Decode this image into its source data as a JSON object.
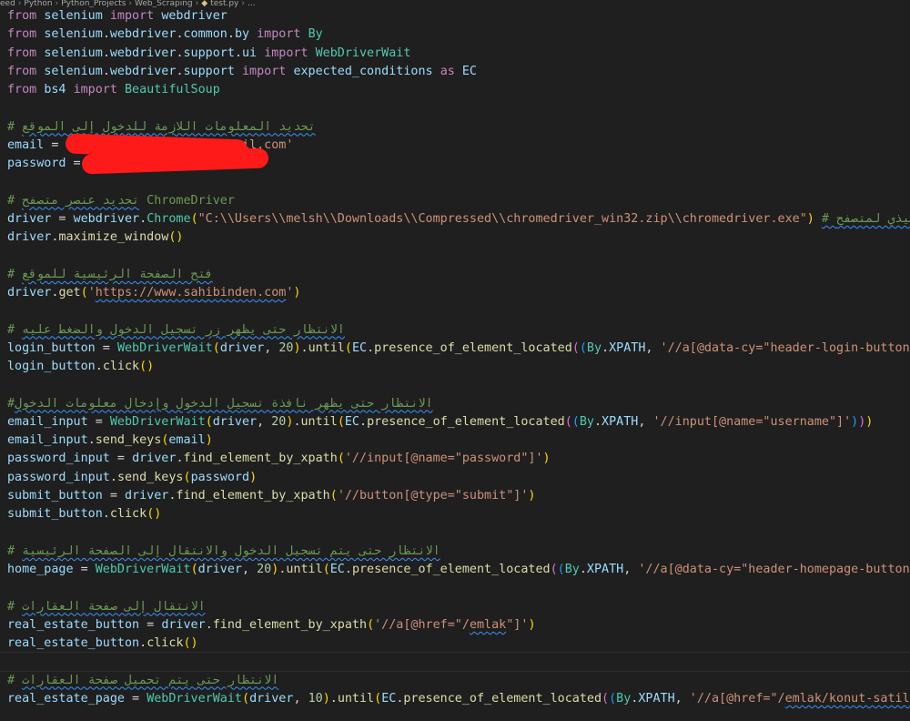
{
  "breadcrumb": [
    "eed",
    "Python",
    "Python_Projects",
    "Web_Scraping",
    "test.py",
    "..."
  ],
  "colors": {
    "background": "#1f1f1f",
    "keyword": "#c586c0",
    "variable": "#9cdcfe",
    "function": "#dcdcaa",
    "class": "#4ec9b0",
    "string": "#ce9178",
    "number": "#b5cea8",
    "comment": "#6a9955",
    "redaction": "#ff1a1a"
  },
  "code_lines": [
    [
      [
        "from",
        "kw"
      ],
      [
        " ",
        ""
      ],
      [
        "selenium",
        "var"
      ],
      [
        " ",
        ""
      ],
      [
        "import",
        "kw"
      ],
      [
        " ",
        ""
      ],
      [
        "webdriver",
        "var"
      ]
    ],
    [
      [
        "from",
        "kw"
      ],
      [
        " ",
        ""
      ],
      [
        "selenium",
        "var"
      ],
      [
        ".",
        ""
      ],
      [
        "webdriver",
        "var"
      ],
      [
        ".",
        ""
      ],
      [
        "common",
        "var"
      ],
      [
        ".",
        ""
      ],
      [
        "by",
        "var"
      ],
      [
        " ",
        ""
      ],
      [
        "import",
        "kw"
      ],
      [
        " ",
        ""
      ],
      [
        "By",
        "cls"
      ]
    ],
    [
      [
        "from",
        "kw"
      ],
      [
        " ",
        ""
      ],
      [
        "selenium",
        "var"
      ],
      [
        ".",
        ""
      ],
      [
        "webdriver",
        "var"
      ],
      [
        ".",
        ""
      ],
      [
        "support",
        "var"
      ],
      [
        ".",
        ""
      ],
      [
        "ui",
        "var"
      ],
      [
        " ",
        ""
      ],
      [
        "import",
        "kw"
      ],
      [
        " ",
        ""
      ],
      [
        "WebDriverWait",
        "cls"
      ]
    ],
    [
      [
        "from",
        "kw"
      ],
      [
        " ",
        ""
      ],
      [
        "selenium",
        "var"
      ],
      [
        ".",
        ""
      ],
      [
        "webdriver",
        "var"
      ],
      [
        ".",
        ""
      ],
      [
        "support",
        "var"
      ],
      [
        " ",
        ""
      ],
      [
        "import",
        "kw"
      ],
      [
        " ",
        ""
      ],
      [
        "expected_conditions",
        "var"
      ],
      [
        " ",
        ""
      ],
      [
        "as",
        "kw"
      ],
      [
        " ",
        ""
      ],
      [
        "EC",
        "var"
      ]
    ],
    [
      [
        "from",
        "kw"
      ],
      [
        " ",
        ""
      ],
      [
        "bs4",
        "var"
      ],
      [
        " ",
        ""
      ],
      [
        "import",
        "kw"
      ],
      [
        " ",
        ""
      ],
      [
        "BeautifulSoup",
        "cls"
      ]
    ],
    [],
    [
      [
        "# ",
        "com"
      ],
      [
        "تحديد المعلومات اللازمة للدخول إلى الموقع",
        "com sq"
      ]
    ],
    [
      [
        "email",
        "var"
      ],
      [
        " = ",
        ""
      ],
      [
        "'",
        "str"
      ],
      [
        "                   ",
        "str"
      ],
      [
        "@gmail.com'",
        "str"
      ]
    ],
    [
      [
        "password",
        "var"
      ],
      [
        " = ",
        ""
      ],
      [
        "'",
        "str"
      ],
      [
        "              '",
        "str"
      ]
    ],
    [],
    [
      [
        "# ",
        "com"
      ],
      [
        "تحديد عنصر متصفح",
        "com sq"
      ],
      [
        " ChromeDriver",
        "com"
      ]
    ],
    [
      [
        "driver",
        "var"
      ],
      [
        " = ",
        ""
      ],
      [
        "webdriver",
        "var"
      ],
      [
        ".",
        ""
      ],
      [
        "Chrome",
        "cls"
      ],
      [
        "(",
        "p1"
      ],
      [
        "\"C:\\\\Users\\\\melsh\\\\Downloads\\\\Compressed\\\\chromedriver_win32.zip\\\\chromedriver.exe\"",
        "str"
      ],
      [
        ")",
        "p1"
      ],
      [
        " ",
        ""
      ],
      [
        "# مسار الملف التنفيذي لمتصفح",
        "com sq"
      ]
    ],
    [
      [
        "driver",
        "var"
      ],
      [
        ".",
        ""
      ],
      [
        "maximize_window",
        "fn"
      ],
      [
        "()",
        "p1"
      ]
    ],
    [],
    [
      [
        "# ",
        "com"
      ],
      [
        "فتح الصفحة الرئيسية للموقع",
        "com sq"
      ]
    ],
    [
      [
        "driver",
        "var"
      ],
      [
        ".",
        ""
      ],
      [
        "get",
        "fn"
      ],
      [
        "(",
        "p1"
      ],
      [
        "'",
        "str"
      ],
      [
        "https://www.sahibinden.com",
        "str sq"
      ],
      [
        "'",
        "str"
      ],
      [
        ")",
        "p1"
      ]
    ],
    [],
    [
      [
        "# ",
        "com"
      ],
      [
        "الانتظار حتى يظهر زر تسجيل الدخول والضغط عليه",
        "com sq"
      ]
    ],
    [
      [
        "login_button",
        "var"
      ],
      [
        " = ",
        ""
      ],
      [
        "WebDriverWait",
        "cls"
      ],
      [
        "(",
        "p1"
      ],
      [
        "driver",
        "var"
      ],
      [
        ", ",
        ""
      ],
      [
        "20",
        "num"
      ],
      [
        ")",
        "p1"
      ],
      [
        ".",
        ""
      ],
      [
        "until",
        "fn"
      ],
      [
        "(",
        "p1"
      ],
      [
        "EC",
        "var"
      ],
      [
        ".",
        ""
      ],
      [
        "presence_of_element_located",
        "fn"
      ],
      [
        "(",
        "p2"
      ],
      [
        "(",
        "p3"
      ],
      [
        "By",
        "cls"
      ],
      [
        ".",
        ""
      ],
      [
        "XPATH",
        "var"
      ],
      [
        ", ",
        ""
      ],
      [
        "'//a[@data-cy=\"header-login-button\"]'",
        "str"
      ],
      [
        ")",
        "p3"
      ],
      [
        ")",
        "p2"
      ],
      [
        ")",
        "p1"
      ]
    ],
    [
      [
        "login_button",
        "var"
      ],
      [
        ".",
        ""
      ],
      [
        "click",
        "fn"
      ],
      [
        "()",
        "p1"
      ]
    ],
    [],
    [
      [
        "#",
        "com"
      ],
      [
        "الانتظار حتى يظهر نافذة تسجيل الدخول وإدخال معلومات الدخول",
        "com sq"
      ]
    ],
    [
      [
        "email_input",
        "var"
      ],
      [
        " = ",
        ""
      ],
      [
        "WebDriverWait",
        "cls"
      ],
      [
        "(",
        "p1"
      ],
      [
        "driver",
        "var"
      ],
      [
        ", ",
        ""
      ],
      [
        "20",
        "num"
      ],
      [
        ")",
        "p1"
      ],
      [
        ".",
        ""
      ],
      [
        "until",
        "fn"
      ],
      [
        "(",
        "p1"
      ],
      [
        "EC",
        "var"
      ],
      [
        ".",
        ""
      ],
      [
        "presence_of_element_located",
        "fn"
      ],
      [
        "(",
        "p2"
      ],
      [
        "(",
        "p3"
      ],
      [
        "By",
        "cls"
      ],
      [
        ".",
        ""
      ],
      [
        "XPATH",
        "var"
      ],
      [
        ", ",
        ""
      ],
      [
        "'//input[@name=\"username\"]'",
        "str"
      ],
      [
        ")",
        "p3"
      ],
      [
        ")",
        "p2"
      ],
      [
        ")",
        "p1"
      ]
    ],
    [
      [
        "email_input",
        "var"
      ],
      [
        ".",
        ""
      ],
      [
        "send_keys",
        "fn"
      ],
      [
        "(",
        "p1"
      ],
      [
        "email",
        "var"
      ],
      [
        ")",
        "p1"
      ]
    ],
    [
      [
        "password_input",
        "var"
      ],
      [
        " = ",
        ""
      ],
      [
        "driver",
        "var"
      ],
      [
        ".",
        ""
      ],
      [
        "find_element_by_xpath",
        "fn"
      ],
      [
        "(",
        "p1"
      ],
      [
        "'//input[@name=\"password\"]'",
        "str"
      ],
      [
        ")",
        "p1"
      ]
    ],
    [
      [
        "password_input",
        "var"
      ],
      [
        ".",
        ""
      ],
      [
        "send_keys",
        "fn"
      ],
      [
        "(",
        "p1"
      ],
      [
        "password",
        "var"
      ],
      [
        ")",
        "p1"
      ]
    ],
    [
      [
        "submit_button",
        "var"
      ],
      [
        " = ",
        ""
      ],
      [
        "driver",
        "var"
      ],
      [
        ".",
        ""
      ],
      [
        "find_element_by_xpath",
        "fn"
      ],
      [
        "(",
        "p1"
      ],
      [
        "'//button[@type=\"submit\"]'",
        "str"
      ],
      [
        ")",
        "p1"
      ]
    ],
    [
      [
        "submit_button",
        "var"
      ],
      [
        ".",
        ""
      ],
      [
        "click",
        "fn"
      ],
      [
        "()",
        "p1"
      ]
    ],
    [],
    [
      [
        "# ",
        "com"
      ],
      [
        "الانتظار حتى يتم تسجيل الدخول والانتقال إلى الصفحة الرئيسية",
        "com sq"
      ]
    ],
    [
      [
        "home_page",
        "var"
      ],
      [
        " = ",
        ""
      ],
      [
        "WebDriverWait",
        "cls"
      ],
      [
        "(",
        "p1"
      ],
      [
        "driver",
        "var"
      ],
      [
        ", ",
        ""
      ],
      [
        "20",
        "num"
      ],
      [
        ")",
        "p1"
      ],
      [
        ".",
        ""
      ],
      [
        "until",
        "fn"
      ],
      [
        "(",
        "p1"
      ],
      [
        "EC",
        "var"
      ],
      [
        ".",
        ""
      ],
      [
        "presence_of_element_located",
        "fn"
      ],
      [
        "(",
        "p2"
      ],
      [
        "(",
        "p3"
      ],
      [
        "By",
        "cls"
      ],
      [
        ".",
        ""
      ],
      [
        "XPATH",
        "var"
      ],
      [
        ", ",
        ""
      ],
      [
        "'//a[@data-cy=\"header-homepage-button\"]'",
        "str"
      ],
      [
        ")",
        "p3"
      ],
      [
        ")",
        "p2"
      ],
      [
        ")",
        "p1"
      ]
    ],
    [],
    [
      [
        "# ",
        "com"
      ],
      [
        "الانتقال إلى صفحة العقارات",
        "com sq"
      ]
    ],
    [
      [
        "real_estate_button",
        "var"
      ],
      [
        " = ",
        ""
      ],
      [
        "driver",
        "var"
      ],
      [
        ".",
        ""
      ],
      [
        "find_element_by_xpath",
        "fn"
      ],
      [
        "(",
        "p1"
      ],
      [
        "'//a[@href=\"/",
        "str"
      ],
      [
        "emlak",
        "str sq"
      ],
      [
        "\"]'",
        "str"
      ],
      [
        ")",
        "p1"
      ]
    ],
    [
      [
        "real_estate_button",
        "var"
      ],
      [
        ".",
        ""
      ],
      [
        "click",
        "fn"
      ],
      [
        "()",
        "p1"
      ]
    ],
    [],
    [
      [
        "# ",
        "com"
      ],
      [
        "الانتظار حتى يتم تحميل صفحة العقارات",
        "com sq"
      ]
    ],
    [
      [
        "real_estate_page",
        "var"
      ],
      [
        " = ",
        ""
      ],
      [
        "WebDriverWait",
        "cls"
      ],
      [
        "(",
        "p1"
      ],
      [
        "driver",
        "var"
      ],
      [
        ", ",
        ""
      ],
      [
        "10",
        "num"
      ],
      [
        ")",
        "p1"
      ],
      [
        ".",
        ""
      ],
      [
        "until",
        "fn"
      ],
      [
        "(",
        "p1"
      ],
      [
        "EC",
        "var"
      ],
      [
        ".",
        ""
      ],
      [
        "presence_of_element_located",
        "fn"
      ],
      [
        "(",
        "p2"
      ],
      [
        "(",
        "p3"
      ],
      [
        "By",
        "cls"
      ],
      [
        ".",
        ""
      ],
      [
        "XPATH",
        "var"
      ],
      [
        ", ",
        ""
      ],
      [
        "'//a[@href=\"/",
        "str"
      ],
      [
        "emlak/konut-satilik",
        "str sq"
      ],
      [
        "\"]'",
        "str"
      ],
      [
        ")",
        "p3"
      ],
      [
        ")",
        "p2"
      ],
      [
        ")",
        "p1"
      ]
    ]
  ]
}
